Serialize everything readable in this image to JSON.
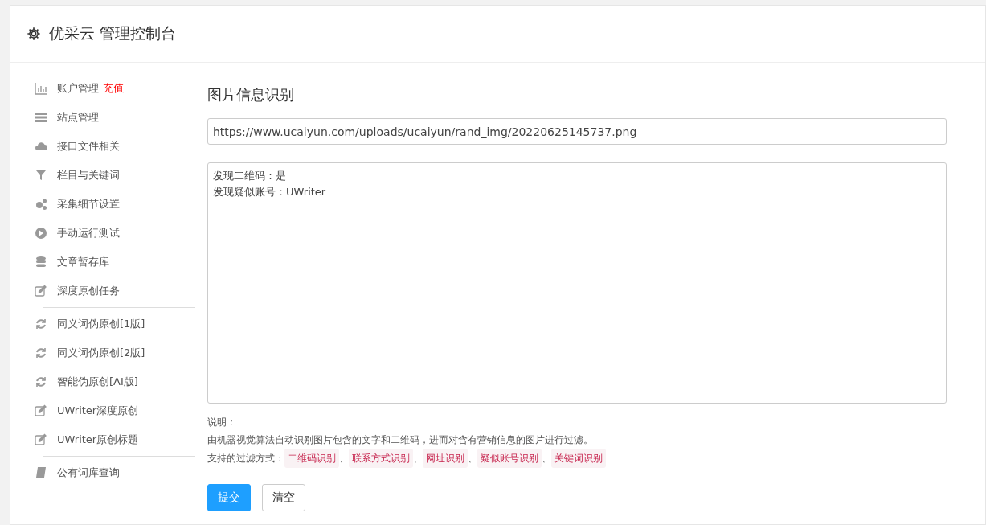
{
  "header": {
    "title": "优采云 管理控制台"
  },
  "sidebar": {
    "groups": [
      {
        "items": [
          {
            "label": "账户管理",
            "badge": "充值"
          },
          {
            "label": "站点管理"
          },
          {
            "label": "接口文件相关"
          },
          {
            "label": "栏目与关键词"
          },
          {
            "label": "采集细节设置"
          },
          {
            "label": "手动运行测试"
          },
          {
            "label": "文章暂存库"
          },
          {
            "label": "深度原创任务"
          }
        ]
      },
      {
        "items": [
          {
            "label": "同义词伪原创[1版]"
          },
          {
            "label": "同义词伪原创[2版]"
          },
          {
            "label": "智能伪原创[AI版]"
          },
          {
            "label": "UWriter深度原创"
          },
          {
            "label": "UWriter原创标题"
          }
        ]
      },
      {
        "items": [
          {
            "label": "公有词库查询"
          }
        ]
      }
    ]
  },
  "content": {
    "heading": "图片信息识别",
    "url_field": {
      "value": "https://www.ucaiyun.com/uploads/ucaiyun/rand_img/20220625145737.png"
    },
    "result_lines": [
      "发现二维码：是",
      "发现疑似账号：UWriter"
    ],
    "note_title": "说明：",
    "note_text": "由机器视觉算法自动识别图片包含的文字和二维码，进而对含有营销信息的图片进行过滤。",
    "methods_label": "支持的过滤方式：",
    "methods": [
      "二维码识别",
      "联系方式识别",
      "网址识别",
      "疑似账号识别",
      "关键词识别"
    ],
    "separator": "、",
    "buttons": [
      {
        "label": "提交",
        "kind": "primary"
      },
      {
        "label": "清空",
        "kind": "default"
      }
    ]
  }
}
